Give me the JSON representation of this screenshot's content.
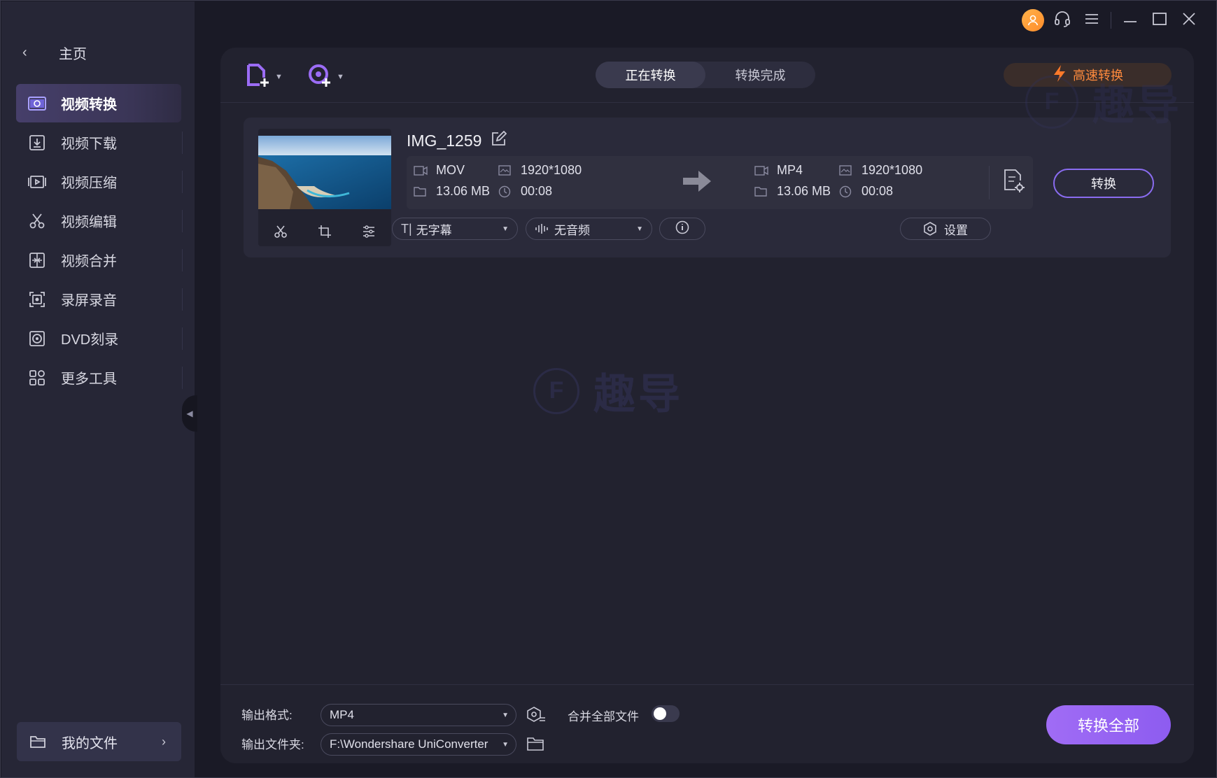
{
  "sidebar": {
    "home_label": "主页",
    "items": [
      {
        "label": "视频转换",
        "icon": "video-convert-icon",
        "active": true
      },
      {
        "label": "视频下载",
        "icon": "download-icon"
      },
      {
        "label": "视频压缩",
        "icon": "compress-icon"
      },
      {
        "label": "视频编辑",
        "icon": "scissors-icon"
      },
      {
        "label": "视频合并",
        "icon": "merge-icon"
      },
      {
        "label": "录屏录音",
        "icon": "screen-record-icon"
      },
      {
        "label": "DVD刻录",
        "icon": "dvd-icon"
      },
      {
        "label": "更多工具",
        "icon": "grid-icon"
      }
    ],
    "my_files_label": "我的文件"
  },
  "toolbar": {
    "tabs": [
      "正在转换",
      "转换完成"
    ],
    "active_tab": "正在转换",
    "speed_label": "高速转换"
  },
  "file": {
    "name": "IMG_1259",
    "source": {
      "format": "MOV",
      "resolution": "1920*1080",
      "size": "13.06 MB",
      "duration": "00:08"
    },
    "target": {
      "format": "MP4",
      "resolution": "1920*1080",
      "size": "13.06 MB",
      "duration": "00:08"
    },
    "convert_label": "转换",
    "subtitle_label": "无字幕",
    "audio_label": "无音频",
    "settings_label": "设置"
  },
  "watermark": {
    "text": "趣导",
    "letter": "F"
  },
  "bottom": {
    "output_format_label": "输出格式:",
    "output_format_value": "MP4",
    "merge_label": "合并全部文件",
    "merge_enabled": false,
    "output_folder_label": "输出文件夹:",
    "output_folder_value": "F:\\Wondershare UniConverter",
    "convert_all_label": "转换全部"
  },
  "colors": {
    "accent": "#9b6cf5",
    "speed": "#ff8a3d",
    "avatar": "#ff9c35"
  }
}
